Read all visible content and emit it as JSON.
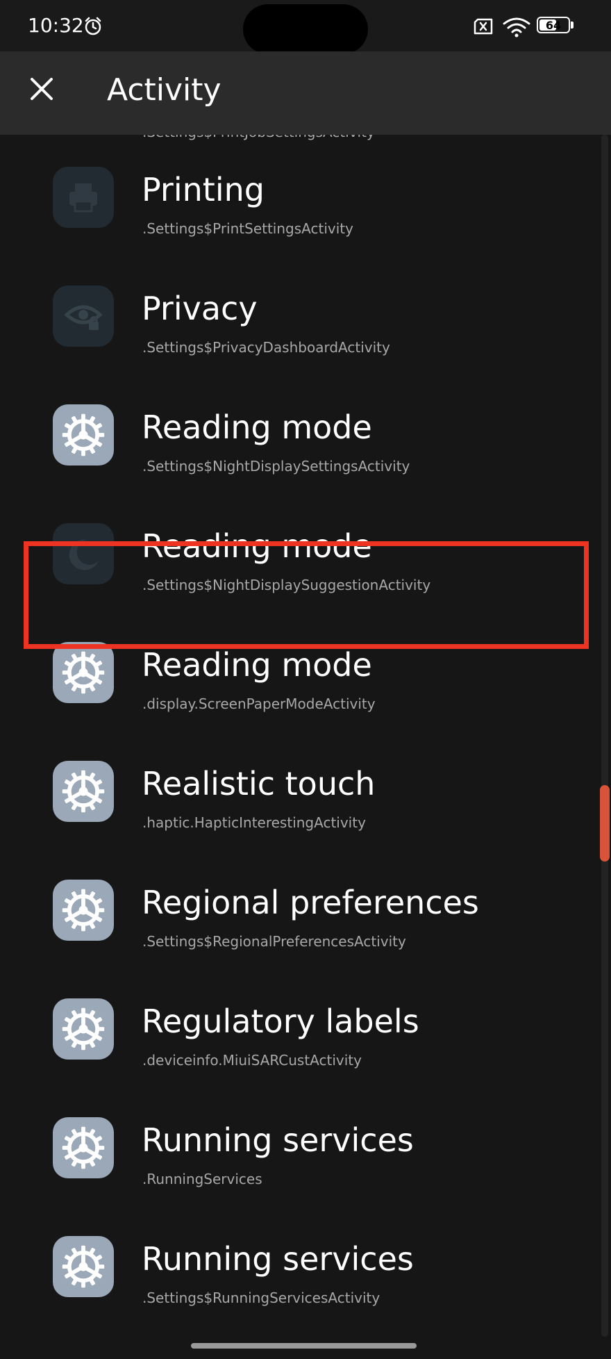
{
  "status_bar": {
    "time": "10:32",
    "alarm_icon": "alarm-clock-icon",
    "sim_icon": "no-sim-icon",
    "wifi_icon": "wifi-icon",
    "battery_level": "64",
    "battery_percent": 64
  },
  "app_bar": {
    "close_icon": "close-icon",
    "title": "Activity"
  },
  "colors": {
    "highlight": "#ee3322",
    "scroll_thumb": "#d9533a",
    "gear_icon_bg": "#9aa8b8"
  },
  "list": {
    "items": [
      {
        "title": "",
        "subtitle": ".Settings$PrintJobSettingsActivity",
        "icon": "printer-job-icon"
      },
      {
        "title": "Printing",
        "subtitle": ".Settings$PrintSettingsActivity",
        "icon": "printer-icon"
      },
      {
        "title": "Privacy",
        "subtitle": ".Settings$PrivacyDashboardActivity",
        "icon": "eye-lock-icon"
      },
      {
        "title": "Reading mode",
        "subtitle": ".Settings$NightDisplaySettingsActivity",
        "icon": "settings-gear-icon"
      },
      {
        "title": "Reading mode",
        "subtitle": ".Settings$NightDisplaySuggestionActivity",
        "icon": "moon-icon",
        "highlighted": true
      },
      {
        "title": "Reading mode",
        "subtitle": ".display.ScreenPaperModeActivity",
        "icon": "settings-gear-icon"
      },
      {
        "title": "Realistic touch",
        "subtitle": ".haptic.HapticInterestingActivity",
        "icon": "settings-gear-icon"
      },
      {
        "title": "Regional preferences",
        "subtitle": ".Settings$RegionalPreferencesActivity",
        "icon": "settings-gear-icon"
      },
      {
        "title": "Regulatory labels",
        "subtitle": ".deviceinfo.MiuiSARCustActivity",
        "icon": "settings-gear-icon"
      },
      {
        "title": "Running services",
        "subtitle": ".RunningServices",
        "icon": "settings-gear-icon"
      },
      {
        "title": "Running services",
        "subtitle": ".Settings$RunningServicesActivity",
        "icon": "settings-gear-icon"
      }
    ]
  }
}
